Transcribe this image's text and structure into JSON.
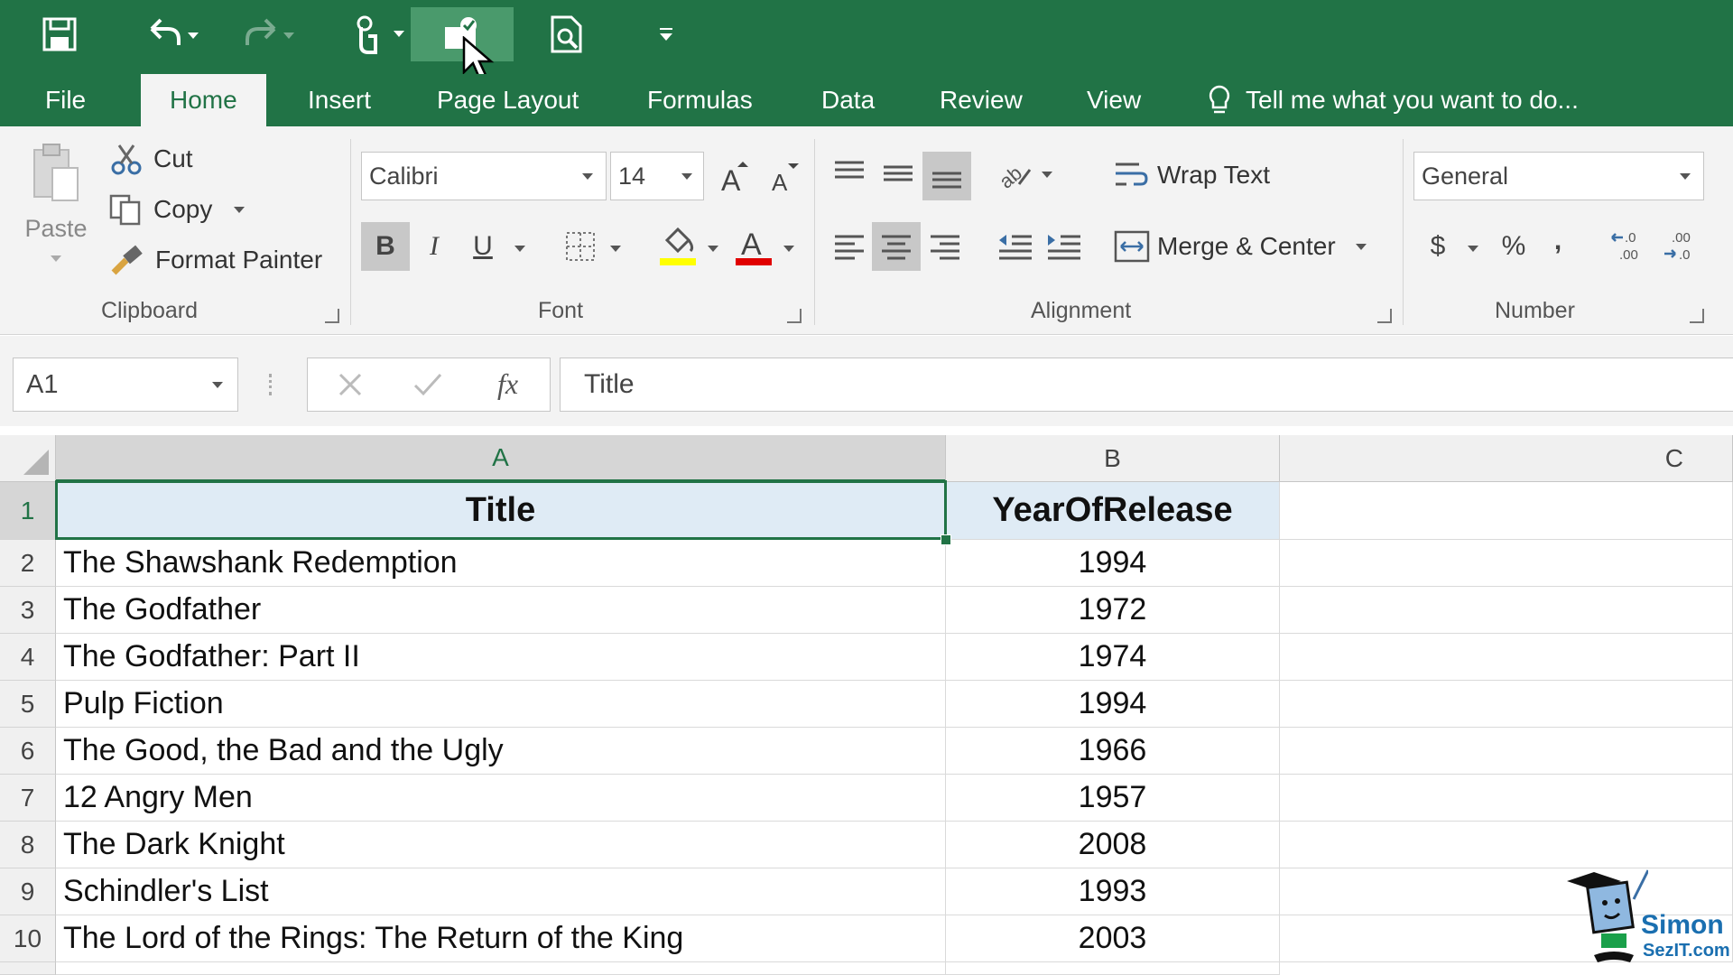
{
  "tabs": {
    "file": "File",
    "home": "Home",
    "insert": "Insert",
    "page_layout": "Page Layout",
    "formulas": "Formulas",
    "data": "Data",
    "review": "Review",
    "view": "View",
    "tell_me": "Tell me what you want to do..."
  },
  "clipboard": {
    "paste": "Paste",
    "cut": "Cut",
    "copy": "Copy",
    "format_painter": "Format Painter",
    "label": "Clipboard"
  },
  "font": {
    "name": "Calibri",
    "size": "14",
    "bold": "B",
    "italic": "I",
    "underline": "U",
    "label": "Font"
  },
  "alignment": {
    "wrap_text": "Wrap Text",
    "merge_center": "Merge & Center",
    "label": "Alignment"
  },
  "number": {
    "format": "General",
    "currency": "$",
    "percent": "%",
    "comma": ",",
    "label": "Number"
  },
  "formula_bar": {
    "name_box": "A1",
    "fx": "fx",
    "content": "Title"
  },
  "columns": [
    "A",
    "B",
    "C"
  ],
  "rows": [
    {
      "num": "1",
      "title": "Title",
      "year": "YearOfRelease"
    },
    {
      "num": "2",
      "title": "The Shawshank Redemption",
      "year": "1994"
    },
    {
      "num": "3",
      "title": "The Godfather",
      "year": "1972"
    },
    {
      "num": "4",
      "title": "The Godfather: Part II",
      "year": "1974"
    },
    {
      "num": "5",
      "title": "Pulp Fiction",
      "year": "1994"
    },
    {
      "num": "6",
      "title": "The Good, the Bad and the Ugly",
      "year": "1966"
    },
    {
      "num": "7",
      "title": "12 Angry Men",
      "year": "1957"
    },
    {
      "num": "8",
      "title": "The Dark Knight",
      "year": "2008"
    },
    {
      "num": "9",
      "title": "Schindler's List",
      "year": "1993"
    },
    {
      "num": "10",
      "title": "The Lord of the Rings: The Return of the King",
      "year": "2003"
    }
  ],
  "logo": {
    "line1": "Simon",
    "line2": "SezIT.com"
  },
  "colors": {
    "accent": "#217346",
    "font_color": "#e00000",
    "highlight": "#ffff00"
  }
}
